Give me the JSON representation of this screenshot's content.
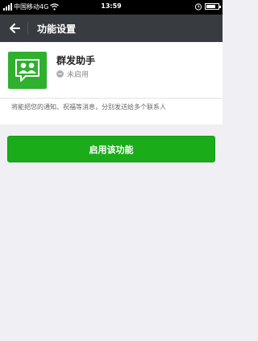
{
  "status_bar": {
    "carrier": "中国移动4G",
    "time": "13:59",
    "battery_level": 0.75
  },
  "header": {
    "back_icon": "arrow-left-icon",
    "title": "功能设置"
  },
  "feature": {
    "icon": "group-users-icon",
    "name": "群发助手",
    "status": "未启用",
    "description": "将能把您的通知、祝福等消息，分别发送给多个联系人"
  },
  "actions": {
    "enable_label": "启用该功能"
  },
  "colors": {
    "accent": "#1aad19",
    "titlebar": "#383b3f"
  }
}
